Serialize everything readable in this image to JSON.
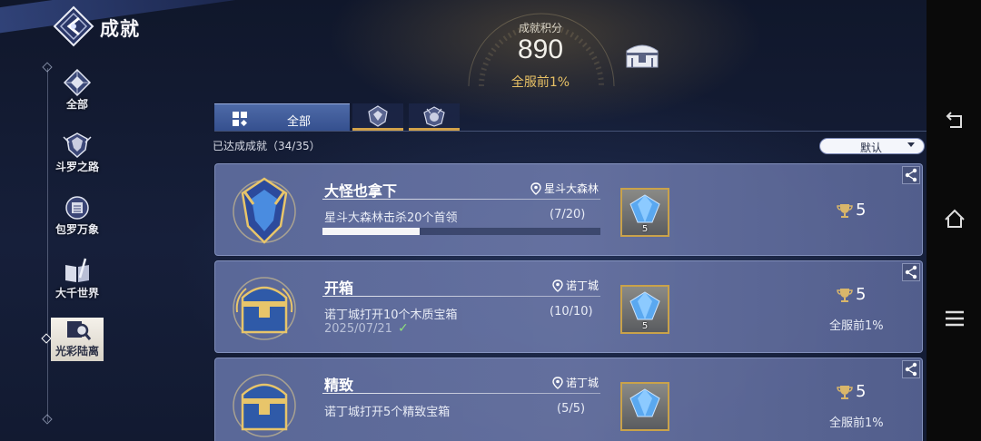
{
  "app": {
    "title": "成就"
  },
  "sidebar": {
    "items": [
      {
        "label": "全部",
        "icon": "diamond-compass-icon",
        "active": false
      },
      {
        "label": "斗罗之路",
        "icon": "crest-icon",
        "active": false
      },
      {
        "label": "包罗万象",
        "icon": "emblem-icon",
        "active": false
      },
      {
        "label": "大千世界",
        "icon": "book-sword-icon",
        "active": false
      },
      {
        "label": "光彩陆离",
        "icon": "camera-magnifier-icon",
        "active": true
      }
    ]
  },
  "header": {
    "score_label": "成就积分",
    "score_value": "890",
    "rank_text": "全服前1%"
  },
  "tabs": [
    {
      "label": "全部",
      "icon": "grid-icon",
      "selected": true
    },
    {
      "label": "",
      "icon": "tier-badge-icon",
      "selected": false
    },
    {
      "label": "",
      "icon": "tier-crest-icon",
      "selected": false
    }
  ],
  "list": {
    "completed_text": "已达成成就（34/35）",
    "sort_value": "默认"
  },
  "cards": [
    {
      "title": "大怪也拿下",
      "location": "星斗大森林",
      "description": "星斗大森林击杀20个首领",
      "count": "(7/20)",
      "progress": 0.35,
      "date": "",
      "reward_qty": "5",
      "points": "5",
      "rank": ""
    },
    {
      "title": "开箱",
      "location": "诺丁城",
      "description": "诺丁城打开10个木质宝箱",
      "count": "(10/10)",
      "progress": null,
      "date": "2025/07/21",
      "reward_qty": "5",
      "points": "5",
      "rank": "全服前1%"
    },
    {
      "title": "精致",
      "location": "诺丁城",
      "description": "诺丁城打开5个精致宝箱",
      "count": "(5/5)",
      "progress": null,
      "date": "",
      "reward_qty": "",
      "points": "5",
      "rank": "全服前1%"
    }
  ],
  "colors": {
    "gold": "#e8c165",
    "tab_active": "#4e6aa7",
    "card_bg": "#6a78a8",
    "gem_blue": "#5aa8f0"
  }
}
